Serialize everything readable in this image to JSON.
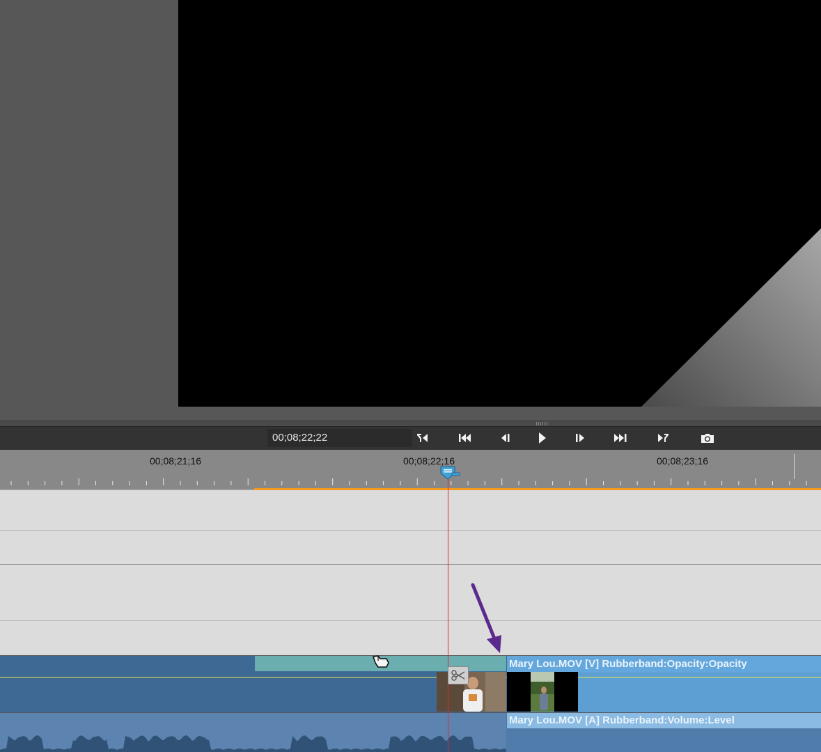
{
  "monitor": {
    "timecode": "00;08;22;22"
  },
  "transport": {
    "buttons": [
      {
        "name": "go-to-in-point",
        "icon": "in-point-icon"
      },
      {
        "name": "go-to-previous-edit",
        "icon": "skip-back-icon"
      },
      {
        "name": "step-back",
        "icon": "step-back-icon"
      },
      {
        "name": "play",
        "icon": "play-icon"
      },
      {
        "name": "step-forward",
        "icon": "step-forward-icon"
      },
      {
        "name": "go-to-next-edit",
        "icon": "skip-forward-icon"
      },
      {
        "name": "go-to-out-point",
        "icon": "out-point-icon"
      },
      {
        "name": "export-frame",
        "icon": "camera-icon"
      }
    ]
  },
  "ruler": {
    "labels": [
      "00;08;21;16",
      "00;08;22;16",
      "00;08;23;16"
    ]
  },
  "clips": {
    "video_label": "Mary Lou.MOV [V] Rubberband:Opacity:Opacity",
    "audio_label": "Mary Lou.MOV [A] Rubberband:Volume:Level"
  },
  "colors": {
    "accent_orange": "#f39a1e",
    "playhead_red": "#e02a2a",
    "annotation_arrow": "#5b2a8c",
    "video_clip": "#5d9fd3",
    "audio_clip": "#4f7caa"
  }
}
